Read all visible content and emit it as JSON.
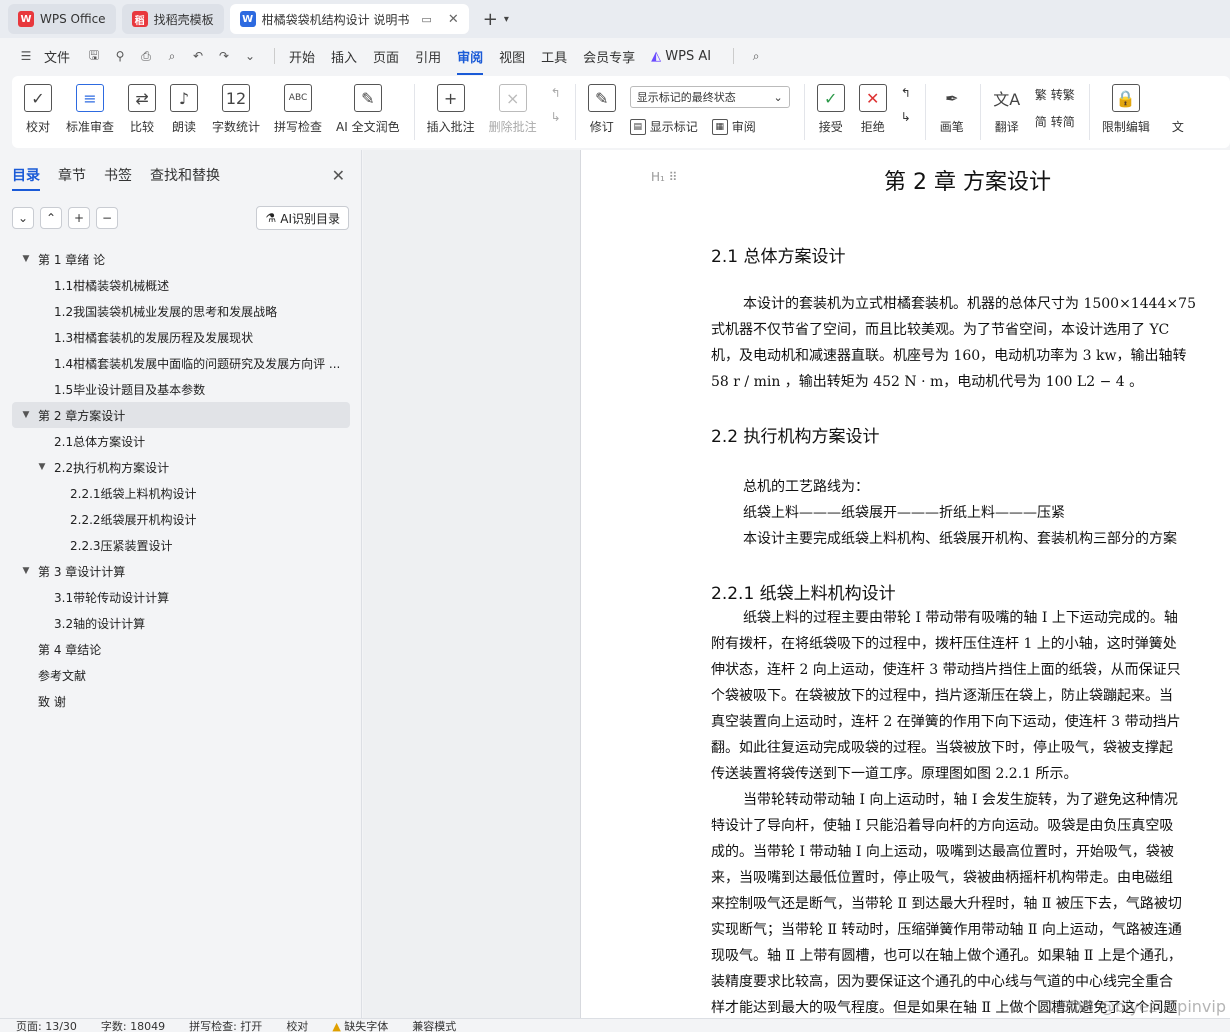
{
  "tabs": [
    {
      "label": "WPS Office",
      "icon": "wps-logo"
    },
    {
      "label": "找稻壳模板",
      "icon": "docer-logo"
    },
    {
      "label": "柑橘袋袋机结构设计 说明书",
      "icon": "writer-logo"
    }
  ],
  "menu": {
    "file": "文件",
    "items": [
      "开始",
      "插入",
      "页面",
      "引用",
      "审阅",
      "视图",
      "工具",
      "会员专享"
    ],
    "active": "审阅",
    "ai": "WPS AI"
  },
  "ribbon": {
    "group1": [
      "校对",
      "标准审查",
      "比较",
      "朗读",
      "字数统计",
      "拼写检查",
      "AI 全文润色"
    ],
    "insert_comment": "插入批注",
    "delete_comment": "删除批注",
    "revise": "修订",
    "display_select": "显示标记的最终状态",
    "show_markup": "显示标记",
    "review": "审阅",
    "accept": "接受",
    "reject": "拒绝",
    "pen": "画笔",
    "translate": "翻译",
    "to_traditional": "转繁",
    "to_simplified": "转简",
    "restrict": "限制编辑",
    "cut": "文"
  },
  "sidebar": {
    "tabs": [
      "目录",
      "章节",
      "书签",
      "查找和替换"
    ],
    "ai_button": "AI识别目录",
    "toc": [
      {
        "label": "第 1 章绪  论",
        "level": 1,
        "arrow": "▼"
      },
      {
        "label": "1.1柑橘装袋机械概述",
        "level": 2
      },
      {
        "label": "1.2我国装袋机械业发展的思考和发展战略",
        "level": 2
      },
      {
        "label": "1.3柑橘套装机的发展历程及发展现状",
        "level": 2
      },
      {
        "label": "1.4柑橘套装机发展中面临的问题研究及发展方向评 ...",
        "level": 2
      },
      {
        "label": "1.5毕业设计题目及基本参数",
        "level": 2
      },
      {
        "label": "第 2 章方案设计",
        "level": 1,
        "arrow": "▼",
        "selected": true
      },
      {
        "label": "2.1总体方案设计",
        "level": 2
      },
      {
        "label": "2.2执行机构方案设计",
        "level": 2,
        "arrow": "▼"
      },
      {
        "label": "2.2.1纸袋上料机构设计",
        "level": 3
      },
      {
        "label": "2.2.2纸袋展开机构设计",
        "level": 3
      },
      {
        "label": "2.2.3压紧装置设计",
        "level": 3
      },
      {
        "label": "第 3 章设计计算",
        "level": 1,
        "arrow": "▼"
      },
      {
        "label": "3.1带轮传动设计计算",
        "level": 2
      },
      {
        "label": "3.2轴的设计计算",
        "level": 2
      },
      {
        "label": "第 4 章结论",
        "level": 1
      },
      {
        "label": "参考文献",
        "level": 1
      },
      {
        "label": "致  谢",
        "level": 1
      }
    ]
  },
  "document": {
    "chapter": "第 2 章  方案设计",
    "s21": "2.1  总体方案设计",
    "p21": [
      "本设计的套装机为立式柑橘套装机。机器的总体尺寸为 1500×1444×75",
      "式机器不仅节省了空间，而且比较美观。为了节省空间，本设计选用了 YC",
      "机，及电动机和减速器直联。机座号为 160，电动机功率为 3 kw，输出轴转",
      "58 r / min ，输出转矩为 452 N · m，电动机代号为 100 L2 − 4 。"
    ],
    "s22": "2.2  执行机构方案设计",
    "p22": [
      "总机的工艺路线为：",
      "纸袋上料———纸袋展开———折纸上料———压紧",
      "本设计主要完成纸袋上料机构、纸袋展开机构、套装机构三部分的方案"
    ],
    "s221": "2.2.1  纸袋上料机构设计",
    "p221": [
      "纸袋上料的过程主要由带轮 Ⅰ 带动带有吸嘴的轴 Ⅰ 上下运动完成的。轴",
      "附有拨杆，在将纸袋吸下的过程中，拨杆压住连杆 1 上的小轴，这时弹簧处",
      "伸状态，连杆 2 向上运动，使连杆 3 带动挡片挡住上面的纸袋，从而保证只",
      "个袋被吸下。在袋被放下的过程中，挡片逐渐压在袋上，防止袋蹦起来。当",
      "真空装置向上运动时，连杆 2 在弹簧的作用下向下运动，使连杆 3 带动挡片",
      "翻。如此往复运动完成吸袋的过程。当袋被放下时，停止吸气，袋被支撑起",
      "传送装置将袋传送到下一道工序。原理图如图 2.2.1 所示。",
      "当带轮转动带动轴 Ⅰ 向上运动时，轴 Ⅰ 会发生旋转，为了避免这种情况",
      "特设计了导向杆，使轴 Ⅰ 只能沿着导向杆的方向运动。吸袋是由负压真空吸",
      "成的。当带轮 Ⅰ 带动轴 Ⅰ 向上运动，吸嘴到达最高位置时，开始吸气，袋被",
      "来，当吸嘴到达最低位置时，停止吸气，袋被曲柄摇杆机构带走。由电磁组",
      "来控制吸气还是断气，当带轮 Ⅱ 到达最大升程时，轴 Ⅱ 被压下去，气路被切",
      "实现断气；当带轮 Ⅱ 转动时，压缩弹簧作用带动轴 Ⅱ 向上运动，气路被连通",
      "现吸气。轴 Ⅱ 上带有圆槽，也可以在轴上做个通孔。如果轴 Ⅱ 上是个通孔，",
      "装精度要求比较高，因为要保证这个通孔的中心线与气道的中心线完全重合",
      "样才能达到最大的吸气程度。但是如果在轴 Ⅱ 上做个圆槽就避免了这个问题",
      "第怎样接触，气道都会打通。"
    ]
  },
  "status": {
    "page": "页面: 13/30",
    "words": "字数: 18049",
    "spell": "拼写检查: 打开",
    "proof": "校对",
    "missing_font": "缺失字体",
    "compat": "兼容模式"
  },
  "watermark": "CSDN @biyezuopinvip",
  "colors": {
    "accent": "#1a5ad7",
    "wps_red": "#e8383d"
  }
}
